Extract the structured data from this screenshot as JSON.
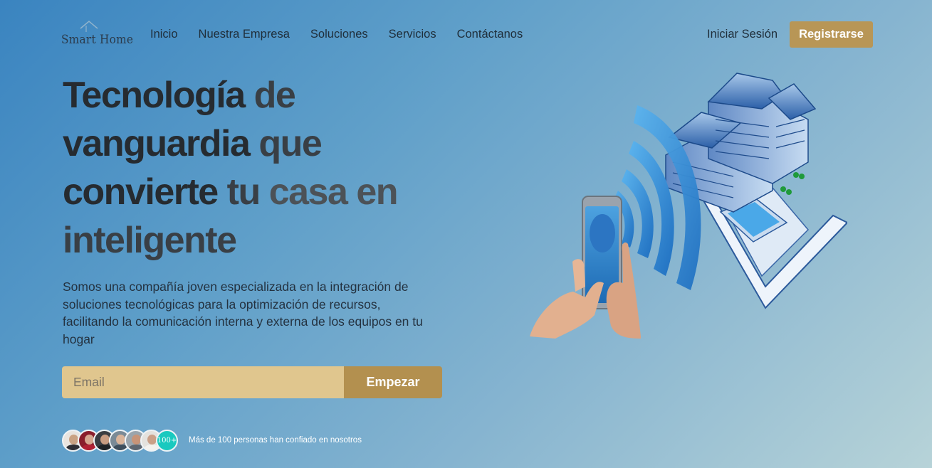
{
  "brand": {
    "name": "Smart Home",
    "logo_icon": "roof-icon"
  },
  "nav": {
    "items": [
      {
        "label": "Inicio"
      },
      {
        "label": "Nuestra Empresa"
      },
      {
        "label": "Soluciones"
      },
      {
        "label": "Servicios"
      },
      {
        "label": "Contáctanos"
      }
    ],
    "login_label": "Iniciar Sesión",
    "register_label": "Registrarse"
  },
  "hero": {
    "title_line1_a": "Tecnología",
    "title_line1_b": "de",
    "title_line2_a": "vanguardia",
    "title_line2_b": "que",
    "title_line3_a": "convierte",
    "title_line3_b": "tu",
    "title_line3_c": "casa",
    "title_line3_d": "en",
    "title_line4": "inteligente",
    "description": "Somos una compañía joven especializada en la integración de soluciones tecnológicas para la optimización de recursos, facilitando la comunicación interna y externa de los equipos en tu hogar",
    "email_placeholder": "Email",
    "cta_label": "Empezar"
  },
  "social_proof": {
    "count_badge": "100+",
    "text": "Más de 100 personas han confiado en nosotros"
  },
  "colors": {
    "accent": "#b89656",
    "input_bg": "#e0c68e",
    "badge": "#19c9bf"
  }
}
